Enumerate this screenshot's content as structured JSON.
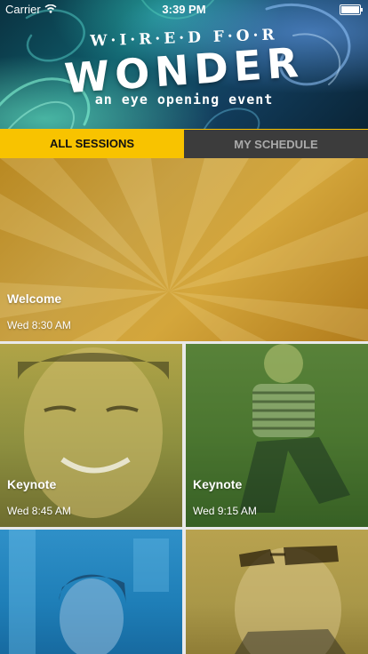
{
  "status_bar": {
    "carrier": "Carrier",
    "time": "3:39 PM"
  },
  "banner": {
    "top_line": "W·I·R·E·D F·O·R",
    "main_line": "WONDER",
    "tagline": "an eye opening event"
  },
  "tabs": {
    "all_sessions": "ALL SESSIONS",
    "my_schedule": "MY SCHEDULE"
  },
  "sessions": [
    {
      "title": "Welcome",
      "time": "Wed 8:30 AM"
    },
    {
      "title": "Keynote",
      "time": "Wed 8:45 AM"
    },
    {
      "title": "Keynote",
      "time": "Wed 9:15 AM"
    }
  ],
  "colors": {
    "accent": "#f8c300",
    "tab_inactive_bg": "#3c3c3c"
  }
}
